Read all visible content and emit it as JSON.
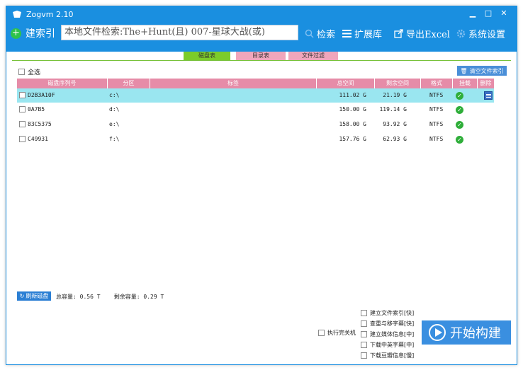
{
  "window": {
    "title": "Zogvm  2.10",
    "min": "▁",
    "max": "□",
    "close": "✕"
  },
  "toolbar": {
    "build_index": "建索引",
    "search_value": "本地文件检索:The+Hunt(且) 007-星球大战(或)",
    "search": "检索",
    "extensions": "扩展库",
    "export_excel": "导出Excel",
    "settings": "系统设置"
  },
  "tabs": [
    "磁盘表",
    "目录表",
    "文件过滤"
  ],
  "select_all": "全选",
  "clear_index": "清空文件索引",
  "table": {
    "columns": [
      "磁盘序列号",
      "分区",
      "标签",
      "总空间",
      "剩余空间",
      "格式",
      "挂载",
      "删除"
    ],
    "rows": [
      {
        "serial": "D2B3A10F",
        "partition": "c:\\",
        "label": "",
        "total": "111.02 G",
        "free": "21.19 G",
        "format": "NTFS",
        "mounted": true,
        "selected": true
      },
      {
        "serial": "0A7B5",
        "partition": "d:\\",
        "label": "",
        "total": "150.00 G",
        "free": "119.14 G",
        "format": "NTFS",
        "mounted": true,
        "selected": false
      },
      {
        "serial": "83C5375",
        "partition": "e:\\",
        "label": "",
        "total": "158.00 G",
        "free": "93.92 G",
        "format": "NTFS",
        "mounted": true,
        "selected": false
      },
      {
        "serial": "C49931",
        "partition": "f:\\",
        "label": "",
        "total": "157.76 G",
        "free": "62.93 G",
        "format": "NTFS",
        "mounted": true,
        "selected": false
      }
    ]
  },
  "footer": {
    "refresh": "刷新磁盘",
    "total_capacity": "总容量: 0.56 T",
    "free_capacity": "剩余容量: 0.29 T",
    "shutdown_after": "执行完关机",
    "options": [
      "建立文件索引[快]",
      "查重与移字幕[快]",
      "建立媒体信息[中]",
      "下载中英字幕[中]",
      "下载豆瓣信息[慢]"
    ],
    "start": "开始构建"
  },
  "colors": {
    "titlebar": "#1a8fe0",
    "tab_active": "#7ccc2a",
    "tab_inactive": "#f0a6bc",
    "header": "#e68ca8",
    "selected_row": "#9ae6f0"
  }
}
